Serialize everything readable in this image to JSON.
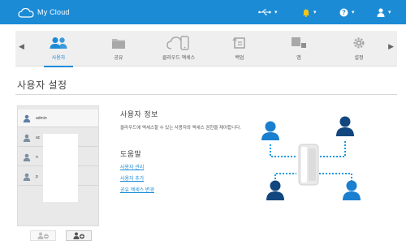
{
  "app": {
    "logo_text": "My Cloud"
  },
  "topbar": {
    "usb_icon": "usb-icon",
    "alert_icon": "bell-icon",
    "help_icon": "help-icon",
    "user_icon": "user-icon",
    "accent": "#1b8bd6"
  },
  "nav": {
    "items": [
      {
        "label": "사용자",
        "icon": "users-icon",
        "active": true
      },
      {
        "label": "공유",
        "icon": "folder-icon",
        "active": false
      },
      {
        "label": "클라우드 액세스",
        "icon": "cloud-access-icon",
        "active": false
      },
      {
        "label": "백업",
        "icon": "backup-icon",
        "active": false
      },
      {
        "label": "앱",
        "icon": "apps-icon",
        "active": false
      },
      {
        "label": "설정",
        "icon": "gear-icon",
        "active": false
      }
    ]
  },
  "page": {
    "title": "사용자 설정"
  },
  "users": [
    {
      "name": "admin",
      "selected": true
    },
    {
      "name": "ac",
      "selected": false
    },
    {
      "name": "n",
      "selected": false
    },
    {
      "name": "p",
      "selected": false
    }
  ],
  "info": {
    "title": "사용자 정보",
    "desc": "클라우드에 액세스할 수 있는 사용자와 액세스 권한을 제어합니다."
  },
  "help": {
    "title": "도움말",
    "links": [
      "사용자 관리",
      "사용자 추가",
      "공유 액세스 변경"
    ]
  }
}
